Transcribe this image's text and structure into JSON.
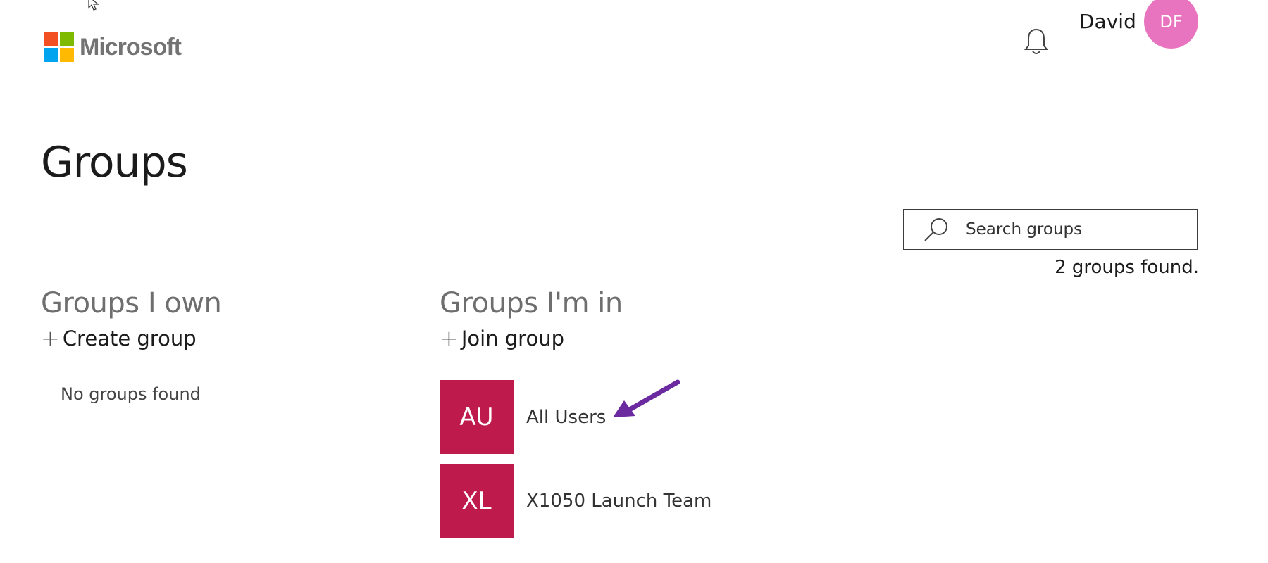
{
  "header": {
    "logo_text": "Microsoft",
    "logo_colors": [
      "#f25022",
      "#7fba00",
      "#00a4ef",
      "#ffb900"
    ],
    "user_name": "David",
    "avatar_initials": "DF",
    "avatar_color": "#e874bf"
  },
  "page": {
    "title": "Groups"
  },
  "search": {
    "placeholder": "Search groups",
    "result_count": "2 groups found."
  },
  "groups_i_own": {
    "heading": "Groups I own",
    "action_label": "Create group",
    "empty_text": "No groups found"
  },
  "groups_im_in": {
    "heading": "Groups I'm in",
    "action_label": "Join group",
    "groups": [
      {
        "initials": "AU",
        "name": "All Users"
      },
      {
        "initials": "XL",
        "name": "X1050 Launch Team"
      }
    ]
  },
  "colors": {
    "tile": "#be1a4c",
    "arrow": "#6b2aa0"
  }
}
